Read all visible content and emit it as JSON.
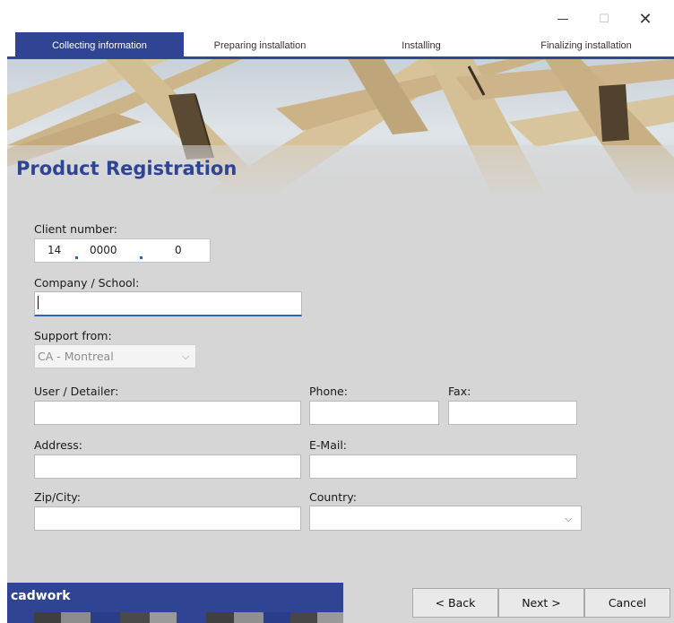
{
  "window": {
    "minimize_glyph": "—",
    "maximize_glyph": "☐",
    "close_glyph": "✕"
  },
  "steps": [
    {
      "label": "Collecting information",
      "active": true
    },
    {
      "label": "Preparing installation",
      "active": false
    },
    {
      "label": "Installing",
      "active": false
    },
    {
      "label": "Finalizing installation",
      "active": false
    }
  ],
  "page": {
    "title": "Product Registration"
  },
  "form": {
    "client_number_label": "Client number:",
    "client_number": {
      "part1": "14",
      "part2": "0000",
      "part3": "0"
    },
    "company_label": "Company / School:",
    "company_value": "",
    "support_label": "Support from:",
    "support_value": "CA - Montreal",
    "user_label": "User / Detailer:",
    "phone_label": "Phone:",
    "fax_label": "Fax:",
    "address_label": "Address:",
    "email_label": "E-Mail:",
    "zip_label": "Zip/City:",
    "country_label": "Country:",
    "country_value": ""
  },
  "footer": {
    "brand": "cadwork",
    "back_label": "< Back",
    "next_label": "Next >",
    "cancel_label": "Cancel"
  },
  "colors": {
    "accent": "#2f4593",
    "focus": "#2f64b4",
    "panel": "#d6d6d6"
  }
}
